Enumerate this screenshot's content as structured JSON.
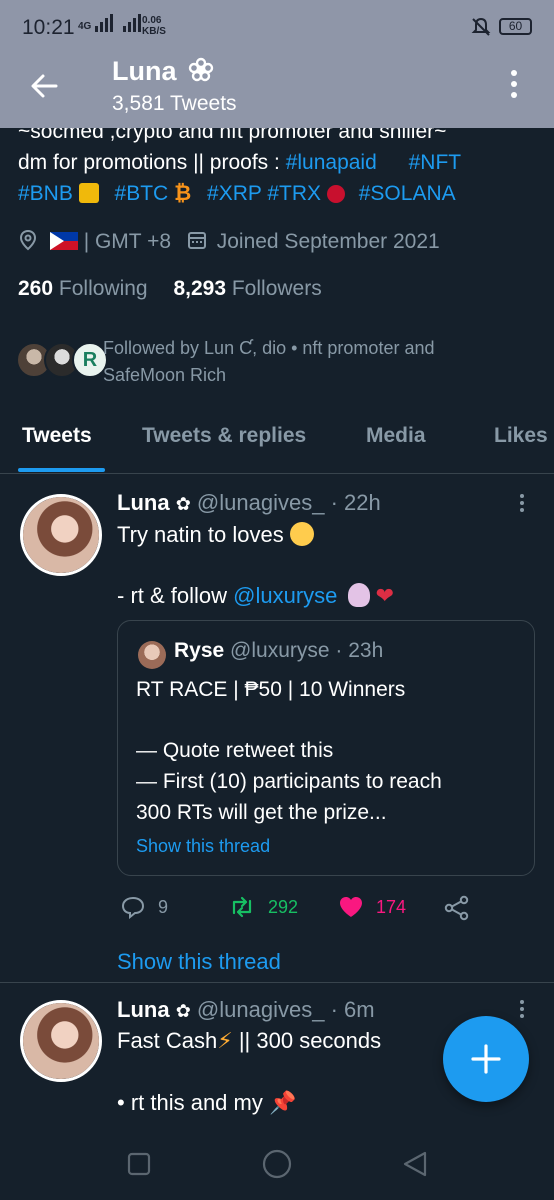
{
  "status": {
    "time": "10:21",
    "network": "4G",
    "speed_value": "0.06",
    "speed_unit": "KB/S",
    "battery": "60"
  },
  "header": {
    "name": "Luna",
    "name_icon": "flower-icon",
    "tweets_count": "3,581 Tweets"
  },
  "bio": {
    "line1": "~socmed ,crypto and nft promoter and shiller~",
    "line2_text": "dm for promotions  || proofs : ",
    "line2_tags": [
      "#lunapaid",
      "#NFT"
    ],
    "line3_tags": [
      "#BNB",
      "#BTC",
      "#XRP",
      "#TRX",
      "#SOLANA"
    ],
    "timezone": " | GMT +8",
    "joined": "Joined September 2021"
  },
  "stats": {
    "following_count": "260",
    "following_label": "Following",
    "followers_count": "8,293",
    "followers_label": "Followers"
  },
  "followed_by": {
    "line1": "Followed by Lun Ƈ, dio • nft promoter and",
    "line2": "SafeMoon Rich"
  },
  "tabs": [
    "Tweets",
    "Tweets & replies",
    "Media",
    "Likes"
  ],
  "tweet1": {
    "name": "Luna",
    "handle": "@lunagives_",
    "time": "· 22h",
    "text1": "Try natin to loves",
    "text2_prefix": "- rt & follow ",
    "text2_mention": "@luxuryse",
    "quote": {
      "name": "Ryse",
      "handle": "@luxuryse",
      "time": "· 23h",
      "line1": "RT RACE | ₱50 | 10 Winners",
      "line2": "— Quote retweet this",
      "line3": "— First (10) participants to reach",
      "line4": "300 RTs will get the prize...",
      "show_thread": "Show this thread"
    },
    "replies": "9",
    "retweets": "292",
    "likes": "174",
    "show_thread": "Show this thread"
  },
  "tweet2": {
    "name": "Luna",
    "handle": "@lunagives_",
    "time": "· 6m",
    "text1": "Fast Cash",
    "text1_suffix": " || 300 seconds",
    "text2": "• rt this and my"
  },
  "colors": {
    "accent": "#1d9bf0",
    "retweet": "#17bf63",
    "like": "#f91880",
    "background": "#15202b",
    "header": "#8f96a8"
  }
}
